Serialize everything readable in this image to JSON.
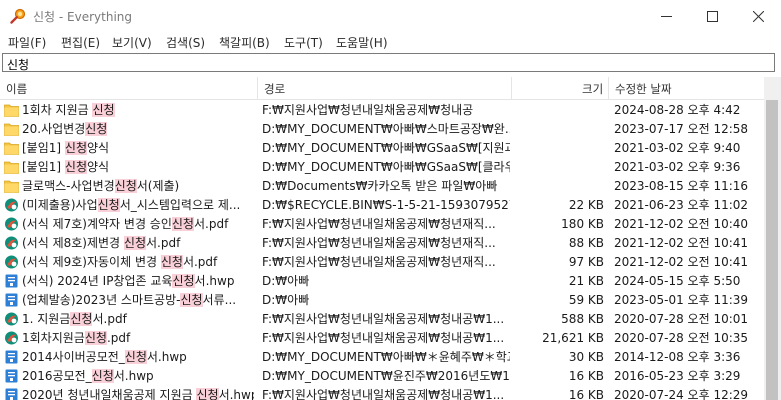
{
  "window": {
    "title": "신청 - Everything",
    "controls": {
      "minimize": "—",
      "maximize": "☐",
      "close": "✕"
    }
  },
  "menu": [
    "파일(F)",
    "편집(E)",
    "보기(V)",
    "검색(S)",
    "책갈피(B)",
    "도구(T)",
    "도움말(H)"
  ],
  "search": {
    "value": "신청"
  },
  "columns": {
    "name": "이름",
    "path": "경로",
    "size": "크기",
    "date": "수정한 날짜"
  },
  "colors": {
    "folder": "#f5c542",
    "highlight": "#f9cfd8",
    "hwp": "#2e7fd6",
    "pdf": "#e0533c",
    "selection": "#cce8ff"
  },
  "rows": [
    {
      "icon": "folder-icon",
      "name_pre": "1회차 지원금 ",
      "name_hl": "신청",
      "name_post": "",
      "path": "F:₩지원사업₩청년내일채움공제₩청내공",
      "size": "",
      "date": "2024-08-28 오후 4:42"
    },
    {
      "icon": "folder-icon",
      "name_pre": "20.사업변경",
      "name_hl": "신청",
      "name_post": "",
      "path": "D:₩MY_DOCUMENT₩아빠₩스마트공장₩완...",
      "size": "",
      "date": "2023-07-17 오전 12:58"
    },
    {
      "icon": "folder-icon",
      "name_pre": "[붙임1] ",
      "name_hl": "신청",
      "name_post": "양식",
      "path": "D:₩MY_DOCUMENT₩아빠₩GSaaS₩[지원과...",
      "size": "",
      "date": "2021-03-02 오후 9:40"
    },
    {
      "icon": "folder-icon",
      "name_pre": "[붙임1] ",
      "name_hl": "신청",
      "name_post": "양식",
      "path": "D:₩MY_DOCUMENT₩아빠₩GSaaS₩[클라우...",
      "size": "",
      "date": "2021-03-02 오후 9:36"
    },
    {
      "icon": "folder-icon",
      "name_pre": "글로맥스-사업변경",
      "name_hl": "신청",
      "name_post": "서(제출)",
      "path": "D:₩Documents₩카카오톡 받은 파일₩아빠",
      "size": "",
      "date": "2023-08-15 오후 11:16"
    },
    {
      "icon": "pdf-icon",
      "name_pre": "(미제출용)사업",
      "name_hl": "신청",
      "name_post": "서_시스템입력으로 제...",
      "path": "D:₩$RECYCLE.BIN₩S-1-5-21-1593079527-...",
      "size": "22 KB",
      "date": "2021-06-23 오후 11:02"
    },
    {
      "icon": "pdf-icon",
      "name_pre": "(서식 제7호)계약자 변경 승인",
      "name_hl": "신청",
      "name_post": "서.pdf",
      "path": "F:₩지원사업₩청년내일채움공제₩청년재직...",
      "size": "180 KB",
      "date": "2021-12-02 오전 10:40"
    },
    {
      "icon": "pdf-icon",
      "name_pre": "(서식 제8호)제변경 ",
      "name_hl": "신청",
      "name_post": "서.pdf",
      "path": "F:₩지원사업₩청년내일채움공제₩청년재직...",
      "size": "88 KB",
      "date": "2021-12-02 오전 10:41"
    },
    {
      "icon": "pdf-icon",
      "name_pre": "(서식 제9호)자동이체 변경 ",
      "name_hl": "신청",
      "name_post": "서.pdf",
      "path": "F:₩지원사업₩청년내일채움공제₩청년재직...",
      "size": "97 KB",
      "date": "2021-12-02 오전 10:41"
    },
    {
      "icon": "hwp-icon",
      "name_pre": "(서식) 2024년 IP창업존 교육",
      "name_hl": "신청",
      "name_post": "서.hwp",
      "path": "D:₩아빠",
      "size": "21 KB",
      "date": "2024-05-15 오후 5:50"
    },
    {
      "icon": "hwp-icon",
      "name_pre": "(업체발송)2023년 스마트공방-",
      "name_hl": "신청",
      "name_post": "서류...",
      "path": "D:₩아빠",
      "size": "59 KB",
      "date": "2023-05-01 오후 11:39"
    },
    {
      "icon": "pdf-icon",
      "name_pre": "1. 지원금",
      "name_hl": "신청",
      "name_post": "서.pdf",
      "path": "F:₩지원사업₩청년내일채움공제₩청내공₩1...",
      "size": "588 KB",
      "date": "2020-07-28 오전 10:01"
    },
    {
      "icon": "pdf-icon",
      "name_pre": "1회차지원금",
      "name_hl": "신청",
      "name_post": ".pdf",
      "path": "F:₩지원사업₩청년내일채움공제₩청내공₩1...",
      "size": "21,621 KB",
      "date": "2020-07-28 오전 10:35"
    },
    {
      "icon": "hwp-icon",
      "name_pre": "2014사이버공모전_",
      "name_hl": "신청",
      "name_post": "서.hwp",
      "path": "D:₩MY_DOCUMENT₩아빠₩＊윤혜주₩＊학교₩20...",
      "size": "30 KB",
      "date": "2014-12-08 오후 3:36"
    },
    {
      "icon": "hwp-icon",
      "name_pre": "2016공모전_",
      "name_hl": "신청",
      "name_post": "서.hwp",
      "path": "D:₩MY_DOCUMENT₩윤진주₩2016년도₩1...",
      "size": "16 KB",
      "date": "2016-05-23 오후 3:29"
    },
    {
      "icon": "hwp-icon",
      "name_pre": "2020년 청년내일채움공제 지원금 ",
      "name_hl": "신청",
      "name_post": "서.hwp",
      "path": "F:₩지원사업₩청년내일채움공제₩청내공₩1...",
      "size": "16 KB",
      "date": "2020-07-24 오후 12:29"
    }
  ]
}
